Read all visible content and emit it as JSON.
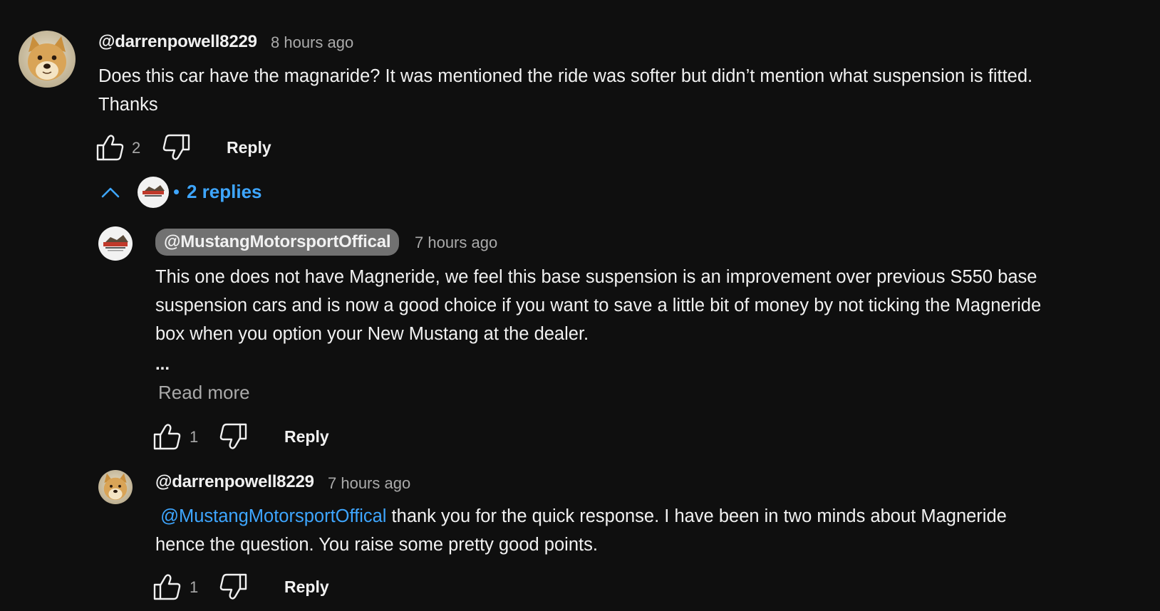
{
  "comment": {
    "author": "@darrenpowell8229",
    "time": "8 hours ago",
    "text_lines": [
      "Does this car have the magnaride? It was mentioned the ride was softer but didn’t mention what suspension is fitted.",
      "Thanks"
    ],
    "likes": "2",
    "reply_label": "Reply",
    "avatar_icon": "doge-dog-avatar"
  },
  "replies_toggle": {
    "label": "2 replies",
    "icon": "chevron-up-icon",
    "accent": "#3ea6ff"
  },
  "replies": [
    {
      "author": "@MustangMotorsportOffical",
      "time": "7 hours ago",
      "text_lines": [
        "This one does not have Magneride, we feel this base suspension is an improvement over previous S550  base",
        "suspension cars and is now a good choice if you want to save a little bit of money by not ticking the Magneride",
        "box when you option your New Mustang at the dealer."
      ],
      "ellipsis": "...",
      "read_more": "Read more",
      "likes": "1",
      "reply_label": "Reply",
      "avatar_icon": "mustang-motorsport-logo",
      "logo_text": "MUSTANG"
    },
    {
      "author": "@darrenpowell8229",
      "time": "7 hours ago",
      "mention": "@MustangMotorsportOffical",
      "text_line1_rest": " thank you for the quick response. I have been in two minds about Magneride",
      "text_line2": "hence the question. You raise some pretty good points.",
      "likes": "1",
      "reply_label": "Reply",
      "avatar_icon": "doge-dog-avatar"
    }
  ],
  "colors": {
    "background": "#0f0f0f",
    "text": "#f1f1f1",
    "secondary": "#aaaaaa",
    "link": "#3ea6ff",
    "chip": "#717171"
  }
}
